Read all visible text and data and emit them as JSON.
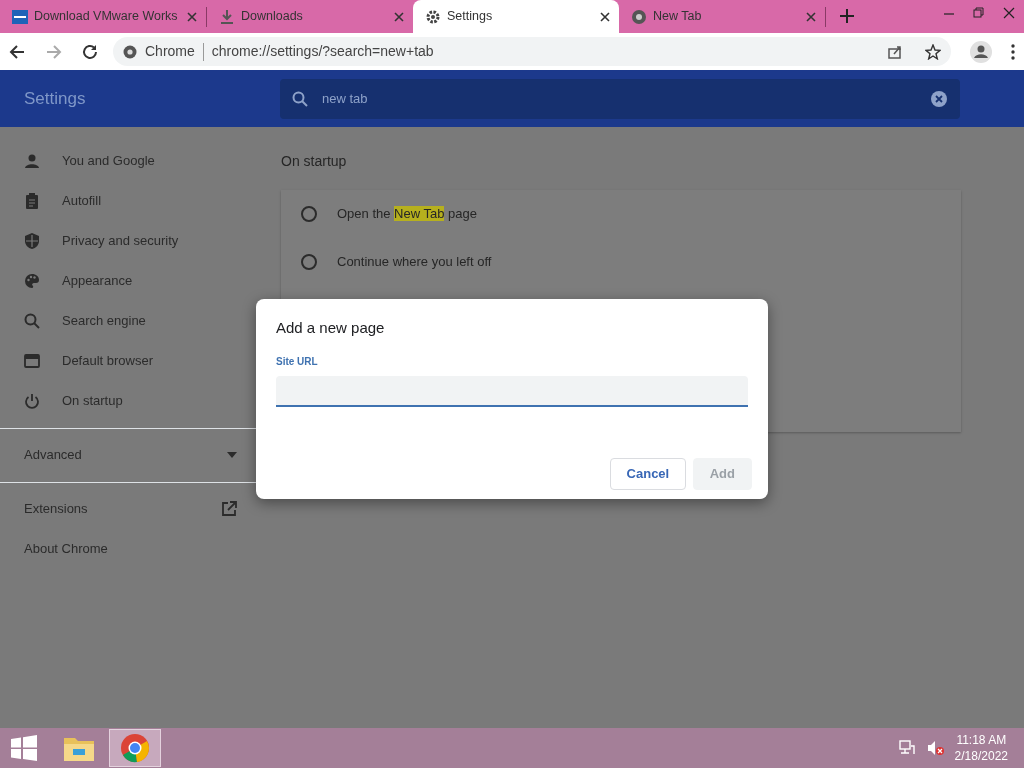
{
  "browser": {
    "tabs": [
      {
        "title": "Download VMware Works",
        "selected": false
      },
      {
        "title": "Downloads",
        "selected": false
      },
      {
        "title": "Settings",
        "selected": true
      },
      {
        "title": "New Tab",
        "selected": false
      }
    ],
    "address": {
      "site_label": "Chrome",
      "url": "chrome://settings/?search=new+tab"
    }
  },
  "settings": {
    "title": "Settings",
    "search": {
      "value": "new tab"
    },
    "sidebar": {
      "items": [
        {
          "label": "You and Google"
        },
        {
          "label": "Autofill"
        },
        {
          "label": "Privacy and security"
        },
        {
          "label": "Appearance"
        },
        {
          "label": "Search engine"
        },
        {
          "label": "Default browser"
        },
        {
          "label": "On startup"
        }
      ],
      "advanced": {
        "label": "Advanced",
        "expanded": false
      },
      "links": [
        {
          "label": "Extensions",
          "external": true
        },
        {
          "label": "About Chrome",
          "external": false
        }
      ]
    },
    "section_title": "On startup",
    "options": [
      {
        "before": "Open the ",
        "highlight": "New Tab",
        "after": " page",
        "selected": false
      },
      {
        "before": "Continue where you left off",
        "selected": false
      }
    ]
  },
  "dialog": {
    "title": "Add a new page",
    "field_label": "Site URL",
    "buttons": [
      {
        "label": "Cancel",
        "disabled": false
      },
      {
        "label": "Add",
        "disabled": true
      }
    ]
  },
  "taskbar": {
    "time": "11:18 AM",
    "date": "2/18/2022"
  }
}
